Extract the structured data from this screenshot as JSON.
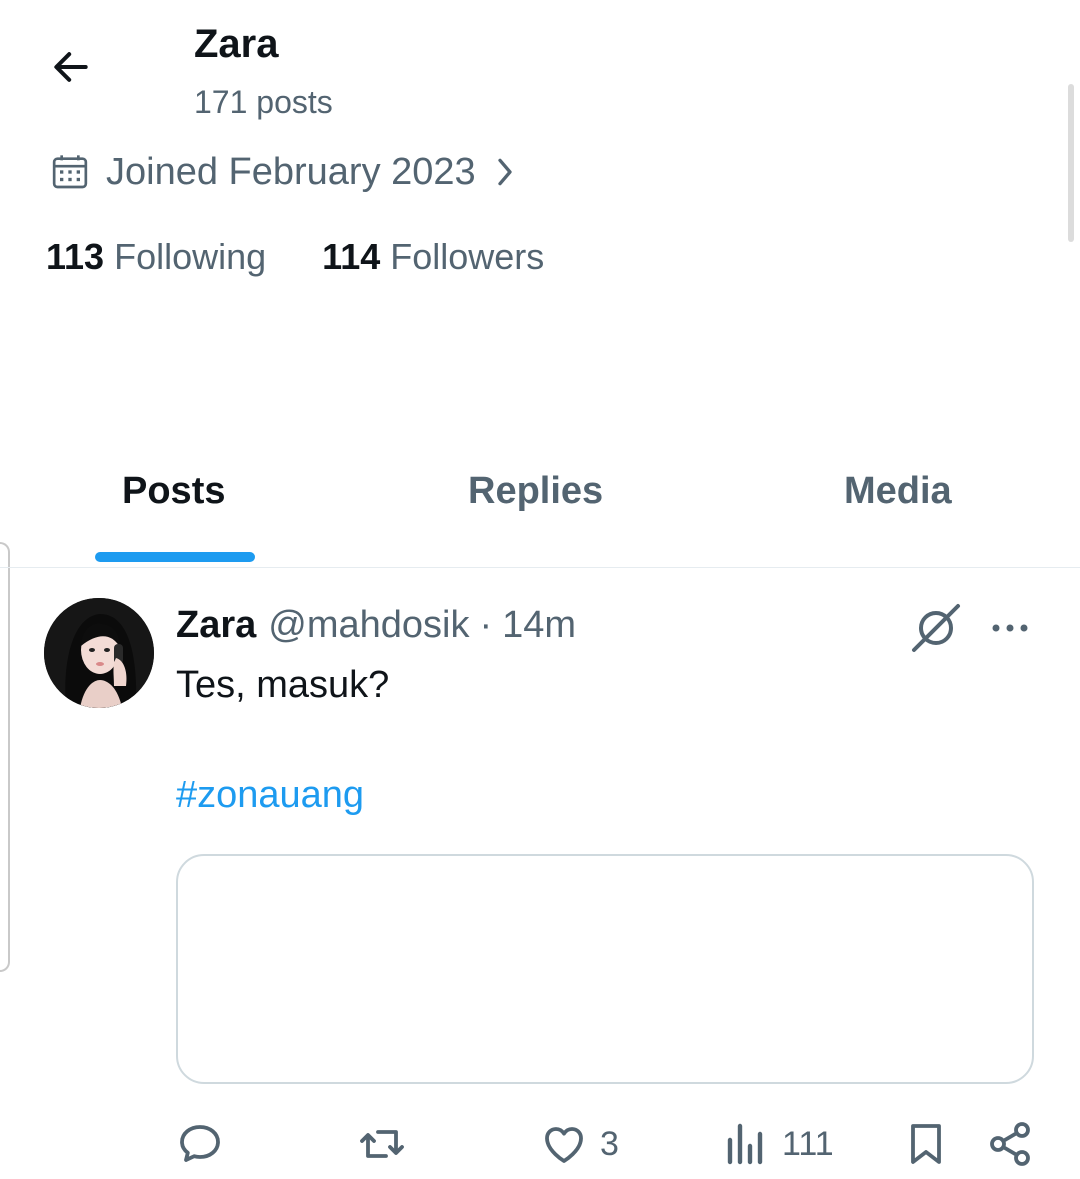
{
  "header": {
    "name": "Zara",
    "post_count": "171 posts"
  },
  "profile": {
    "joined": "Joined February 2023",
    "following_count": "113",
    "following_label": "Following",
    "followers_count": "114",
    "followers_label": "Followers"
  },
  "tabs": [
    {
      "label": "Posts",
      "active": true
    },
    {
      "label": "Replies",
      "active": false
    },
    {
      "label": "Media",
      "active": false
    }
  ],
  "post": {
    "name": "Zara",
    "handle": "@mahdosik",
    "separator": "·",
    "time": "14m",
    "text": "Tes, masuk?",
    "hashtag": "#zonauang",
    "actions": {
      "reply_count": "",
      "repost_count": "",
      "like_count": "3",
      "views_count": "111"
    }
  },
  "colors": {
    "accent": "#1d9bf0",
    "text_primary": "#0f1419",
    "text_secondary": "#536471",
    "border": "#cfd9de"
  },
  "icons": [
    "back-arrow-icon",
    "calendar-icon",
    "chevron-right-icon",
    "grok-icon",
    "more-icon",
    "reply-icon",
    "repost-icon",
    "like-icon",
    "views-icon",
    "bookmark-icon",
    "share-icon"
  ]
}
